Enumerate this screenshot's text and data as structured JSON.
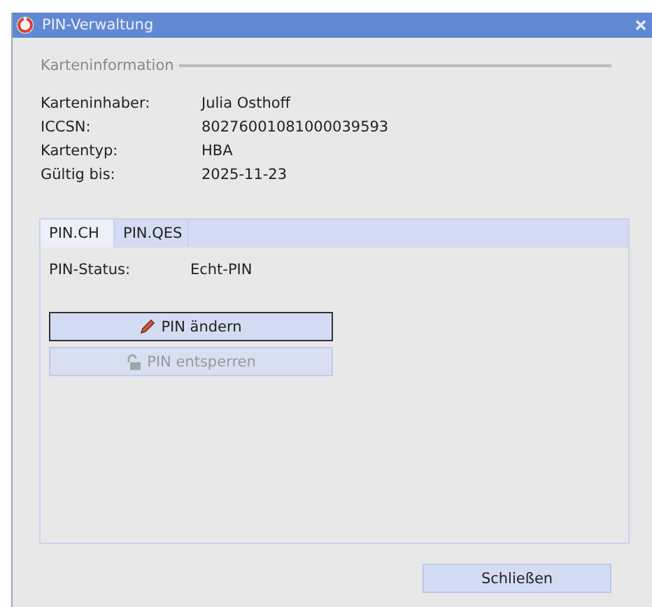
{
  "window": {
    "title": "PIN-Verwaltung"
  },
  "card_info": {
    "legend": "Karteninformation",
    "fields": [
      {
        "label": "Karteninhaber:",
        "value": "Julia Osthoff"
      },
      {
        "label": "ICCSN:",
        "value": "80276001081000039593"
      },
      {
        "label": "Kartentyp:",
        "value": "HBA"
      },
      {
        "label": "Gültig bis:",
        "value": "2025-11-23"
      }
    ]
  },
  "tabs": [
    {
      "label": "PIN.CH",
      "selected": true
    },
    {
      "label": "PIN.QES",
      "selected": false
    }
  ],
  "pin_status": {
    "label": "PIN-Status:",
    "value": "Echt-PIN"
  },
  "actions": [
    {
      "label": "PIN ändern",
      "kind": "pencil",
      "disabled": false,
      "focused": true
    },
    {
      "label": "PIN entsperren",
      "kind": "lock",
      "disabled": true,
      "focused": false
    }
  ],
  "close_button": "Schließen"
}
